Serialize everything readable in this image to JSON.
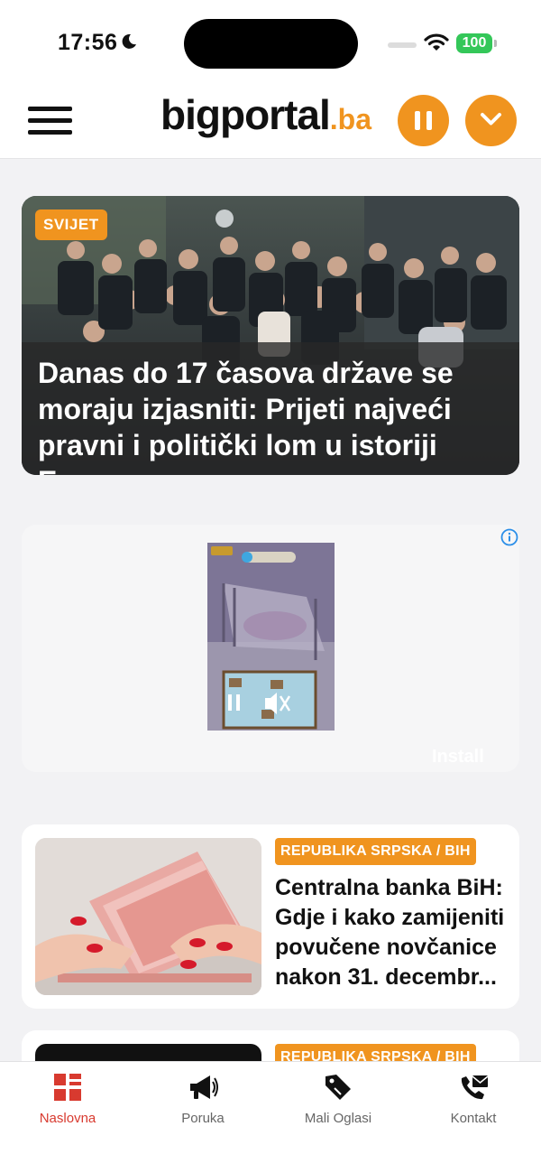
{
  "status_bar": {
    "time": "17:56",
    "battery": "100"
  },
  "header": {
    "logo_main": "bigportal",
    "logo_tld": ".ba",
    "accent_color": "#f0941f"
  },
  "hero": {
    "category": "SVIJET",
    "title": "Danas do 17 časova države se moraju izjasniti: Prijeti najveći pravni i politički lom u istoriji Evr..."
  },
  "ad": {
    "install_label": "Install"
  },
  "news": [
    {
      "category": "REPUBLIKA SRPSKA / BIH",
      "title": "Centralna banka BiH: Gdje i kako zamijeniti povučene novčanice nakon 31. decembr..."
    },
    {
      "category": "REPUBLIKA SRPSKA / BIH"
    }
  ],
  "tabbar": {
    "items": [
      {
        "label": "Naslovna",
        "icon": "home-grid-icon",
        "active": true
      },
      {
        "label": "Poruka",
        "icon": "megaphone-icon",
        "active": false
      },
      {
        "label": "Mali Oglasi",
        "icon": "tag-icon",
        "active": false
      },
      {
        "label": "Kontakt",
        "icon": "phone-mail-icon",
        "active": false
      }
    ],
    "active_color": "#d83a2f"
  }
}
